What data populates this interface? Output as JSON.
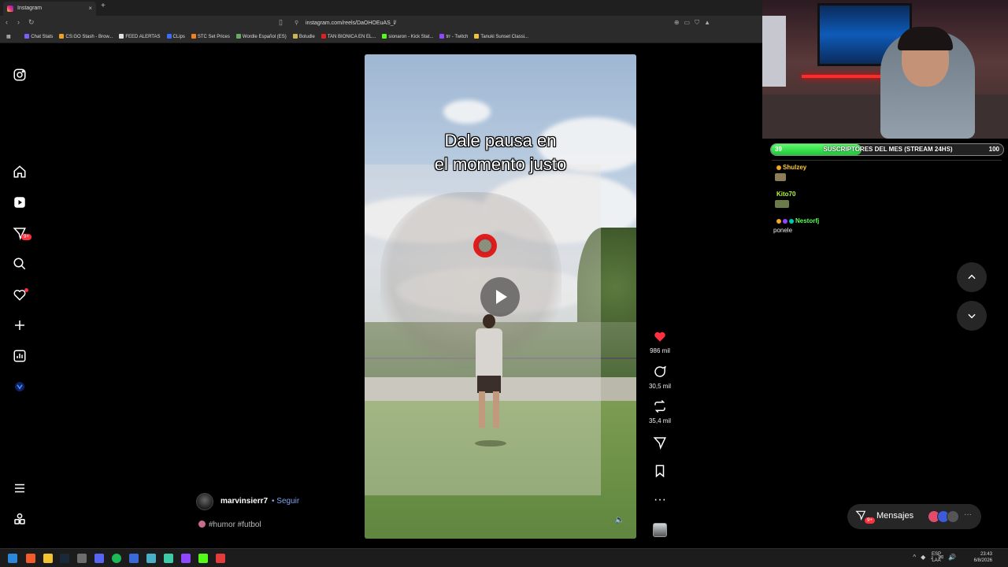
{
  "browser": {
    "tab_title": "Instagram",
    "tab_close": "×",
    "new_tab": "+",
    "url": "instagram.com/reels/DaOHOEuAS_l/",
    "bookmarks": [
      {
        "label": "Chat Stats",
        "color": "#7b5cff"
      },
      {
        "label": "CS:GO Stash - Brow...",
        "color": "#f0a020"
      },
      {
        "label": "FEED ALERTAS",
        "color": "#e0e0e0"
      },
      {
        "label": "CLips",
        "color": "#3a6cff"
      },
      {
        "label": "STC Set Prices",
        "color": "#f08020"
      },
      {
        "label": "Wordle Español (ES)",
        "color": "#6aaa64"
      },
      {
        "label": "Boludle",
        "color": "#c9b458"
      },
      {
        "label": "TAN BIONICA EN EL...",
        "color": "#e02020"
      },
      {
        "label": "sionaron - Kick Stat...",
        "color": "#53fc18"
      },
      {
        "label": "trr - Twitch",
        "color": "#9146ff"
      },
      {
        "label": "Tanuki Sunset Classi...",
        "color": "#f0c040"
      }
    ]
  },
  "sidebar": {
    "notifications_badge": "9+"
  },
  "reel": {
    "caption_line1": "Dale pausa en",
    "caption_line2": "el momento justo",
    "author": "marvinsierr7",
    "follow_label": "• Seguir",
    "description": "#humor #futbol",
    "actions": {
      "likes": "986 mil",
      "comments": "30,5 mil",
      "reposts": "35,4 mil"
    }
  },
  "messages": {
    "label": "Mensajes",
    "badge": "9+"
  },
  "stream": {
    "sub_goal": {
      "start": "39",
      "title": "SUSCRIPTORES DEL MES (STREAM 24HS)",
      "end": "100",
      "progress": 0.39
    },
    "chat": [
      {
        "user": "Shulzey",
        "color": "#ffcc33",
        "text": ""
      },
      {
        "user": "Kito70",
        "color": "#b6ff3a",
        "text": ""
      },
      {
        "user": "Nestorfj",
        "color": "#5aff5a",
        "text": "ponele"
      }
    ]
  },
  "taskbar": {
    "lang_line1": "ESP",
    "lang_line2": "LAA",
    "time": "23:43",
    "date": "6/8/2026"
  },
  "colors": {
    "accent_red": "#ff3040",
    "link_blue": "#7fa3f0",
    "sub_green": "#1fc43a"
  }
}
